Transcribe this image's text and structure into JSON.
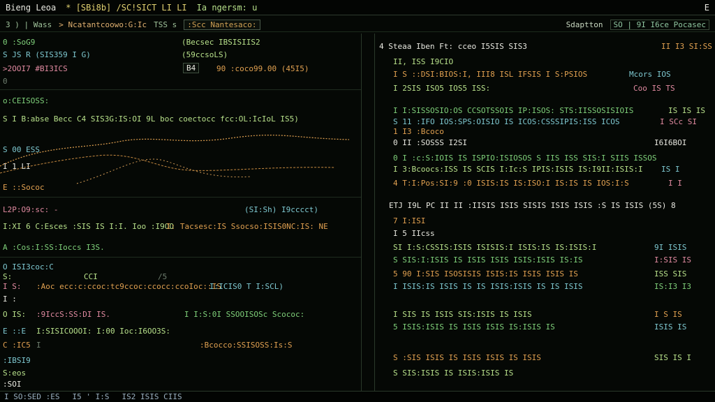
{
  "titlebar": {
    "title": "Bieng Leoa",
    "item1": "* [SBi8b] /SC!SICT LI LI",
    "item2": "Ia ngersm: u",
    "right": "E"
  },
  "toolbar": {
    "item1": "3 ) | Wass",
    "item2": "> Ncatantcoowo:G:Ic",
    "item3": "TSS s",
    "path": ":Scc Nantesaco:",
    "right": "Sdaptton",
    "stats": "SO | 9I I6ce Pocasec"
  },
  "left": {
    "rows": [
      {
        "a": "0 :SoG9",
        "b": "(Becsec IBSISIIS2",
        "c": ""
      },
      {
        "a": "S JS R (SIS359 I G)",
        "b": "(59ccsoLS)",
        "c": ""
      },
      {
        "a": ">2OOI7 #BI3ICS",
        "b": "B4",
        "c": "90 :coco99.00 (45I5)"
      },
      {
        "a": "0",
        "b": "",
        "c": ""
      },
      {
        "a": "o:CEISOSS:",
        "b": "",
        "c": ""
      },
      {
        "a": "S I B:abse Becc C4 SIS3G:IS:OI 9L boc coectocc fcc:OL:IcIoL IS5)",
        "b": "",
        "c": ""
      },
      {
        "a": "S 00 ESS",
        "b": "",
        "c": ""
      },
      {
        "a": "I 1 LI",
        "b": "",
        "c": ""
      },
      {
        "a": "E ::Sococ",
        "b": "",
        "c": ""
      },
      {
        "a": "L2P:O9:sc: -",
        "b": "(SI:Sh) I9cccct)",
        "c": ""
      },
      {
        "a": "I:XI 6 C:Esces :SIS IS I:I. Ioo :I9OO",
        "b": "I: Tacsesc:IS Ssocso:ISIS0NC:IS: NE",
        "c": ""
      },
      {
        "a": "A :Cos:I:SS:Ioccs I3S.",
        "b": "",
        "c": ""
      },
      {
        "a": "O ISI3coc:C",
        "b": "",
        "c": ""
      },
      {
        "a": "S:",
        "b": "CCI",
        "c": "/5"
      },
      {
        "a": "I S:",
        "b": ":Aoc ecc:c:ccoc:tc9ccoc:ccocc:ccoIoc::IS",
        "c": "I:ICIS0  T  I:SCL)"
      },
      {
        "a": "I :",
        "b": "",
        "c": ""
      },
      {
        "a": "O IS:",
        "b": ":9IccS:SS:DI IS.",
        "c": "I I:S:0I SSOOISOSc Scococ:"
      },
      {
        "a": "E ::E",
        "b": "I:SISICOOOI: I:00 Ioc:I6OO3S:",
        "c": ""
      },
      {
        "a": "C :IC5",
        "b": "I",
        "c": ":Bcocco:SSISOSS:Is:S"
      },
      {
        "a": ":IBSI9",
        "b": "",
        "c": ""
      },
      {
        "a": "S:eos",
        "b": "",
        "c": ""
      },
      {
        "a": ":SOI",
        "b": "",
        "c": ""
      }
    ]
  },
  "right": {
    "rows": [
      {
        "a": "4   Steaa Iben Ft: cceo I5SIS SIS3",
        "b": "II I3 SI:SS"
      },
      {
        "a": "II, ISS I9CIO",
        "b": ""
      },
      {
        "a": "I S ::DSI:BIOS:I, III8 ISL IFSIS I S:PSIOS",
        "b": "Mcors IOS"
      },
      {
        "a": "I  2SIS ISO5 IOS5 ISS:",
        "b": "Coo IS TS"
      },
      {
        "a": "I I:SISSOSIO:OS CCSOTSSOIS IP:ISOS: STS:IISSOSISIOIS",
        "b": "IS IS IS"
      },
      {
        "a": "S 11 :IFO IOS:SPS:OISIO IS ICOS:CSSSIPIS:ISS ICOS",
        "b": "I SCc SI"
      },
      {
        "a": "1 I3 :Bcoco",
        "b": ""
      },
      {
        "a": "0 II :SOSSS I2SI",
        "b": "I6I6BOI"
      },
      {
        "a": "0 I :c:S:IOIS IS ISPIO:ISIOSOS S IIS ISS SIS:I SIIS ISSOS",
        "b": ""
      },
      {
        "a": "I  3:Bcoocs:ISS IS SCIS I:Ic:S IPIS:ISIS IS:I9II:ISIS:I",
        "b": "IS I"
      },
      {
        "a": "4  T:I:Pos:SI:9 :0 ISIS:IS IS:ISO:I IS:IS IS IOS:I:S",
        "b": "I  I"
      },
      {
        "a": "ETJ I9L PC II II :IISIS ISIS SISIS ISIS ISIS :S IS ISIS (5S) 8",
        "b": ""
      },
      {
        "a": "7 I:ISI",
        "b": ""
      },
      {
        "a": "I 5 IIcss",
        "b": ""
      },
      {
        "a": "SI I:S:CSSIS:ISIS ISISIS:I ISIS:IS IS:ISIS:I",
        "b": "9I ISIS"
      },
      {
        "a": "S SIS:I:ISIS IS ISIS ISIS ISIS:ISIS IS:IS",
        "b": "I:SIS IS"
      },
      {
        "a": "5 90 I:SIS ISOSISIS ISIS:IS ISIS ISIS IS",
        "b": "ISS SIS"
      },
      {
        "a": "I ISIS:IS ISIS IS IS ISIS:ISIS IS IS ISIS",
        "b": "IS:I3 I3"
      },
      {
        "a": "I SIS IS ISIS SIS:ISIS IS ISIS",
        "b": "I S IS"
      },
      {
        "a": "5 ISIS:ISIS IS ISIS ISIS IS:ISIS IS",
        "b": "ISIS IS"
      },
      {
        "a": "S :SIS ISIS IS ISIS ISIS IS ISIS",
        "b": "SIS IS I"
      },
      {
        "a": "S  SIS:ISIS IS ISIS:ISIS IS",
        "b": ""
      }
    ]
  },
  "status": {
    "a": "I SO:SED :ES",
    "b": "I5 ' I:S",
    "c": "IS2 ISIS CIIS"
  }
}
